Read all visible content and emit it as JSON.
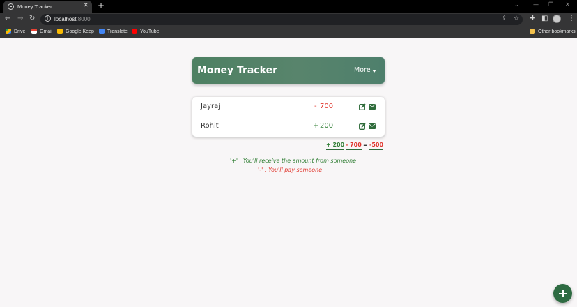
{
  "browser": {
    "tab_title": "Money Tracker",
    "url_host": "localhost",
    "url_port": ":8000",
    "bookmarks": [
      "Drive",
      "Gmail",
      "Google Keep",
      "Translate",
      "YouTube"
    ],
    "other_bookmarks": "Other bookmarks"
  },
  "header": {
    "title": "Money Tracker",
    "more_label": "More"
  },
  "entries": [
    {
      "name": "Jayraj",
      "sign": "-",
      "amount": "700"
    },
    {
      "name": "Rohit",
      "sign": "+",
      "amount": "200"
    }
  ],
  "summary": {
    "positive": "+ 200",
    "negative": "- 700",
    "equals": "=",
    "total": "-500"
  },
  "legend": {
    "receive": "'+' : You'll receive the amount from someone",
    "pay": "'-' : You'll pay someone"
  },
  "colors": {
    "positive": "#2e7d32",
    "negative": "#e0342b",
    "accent": "#4d8062"
  }
}
